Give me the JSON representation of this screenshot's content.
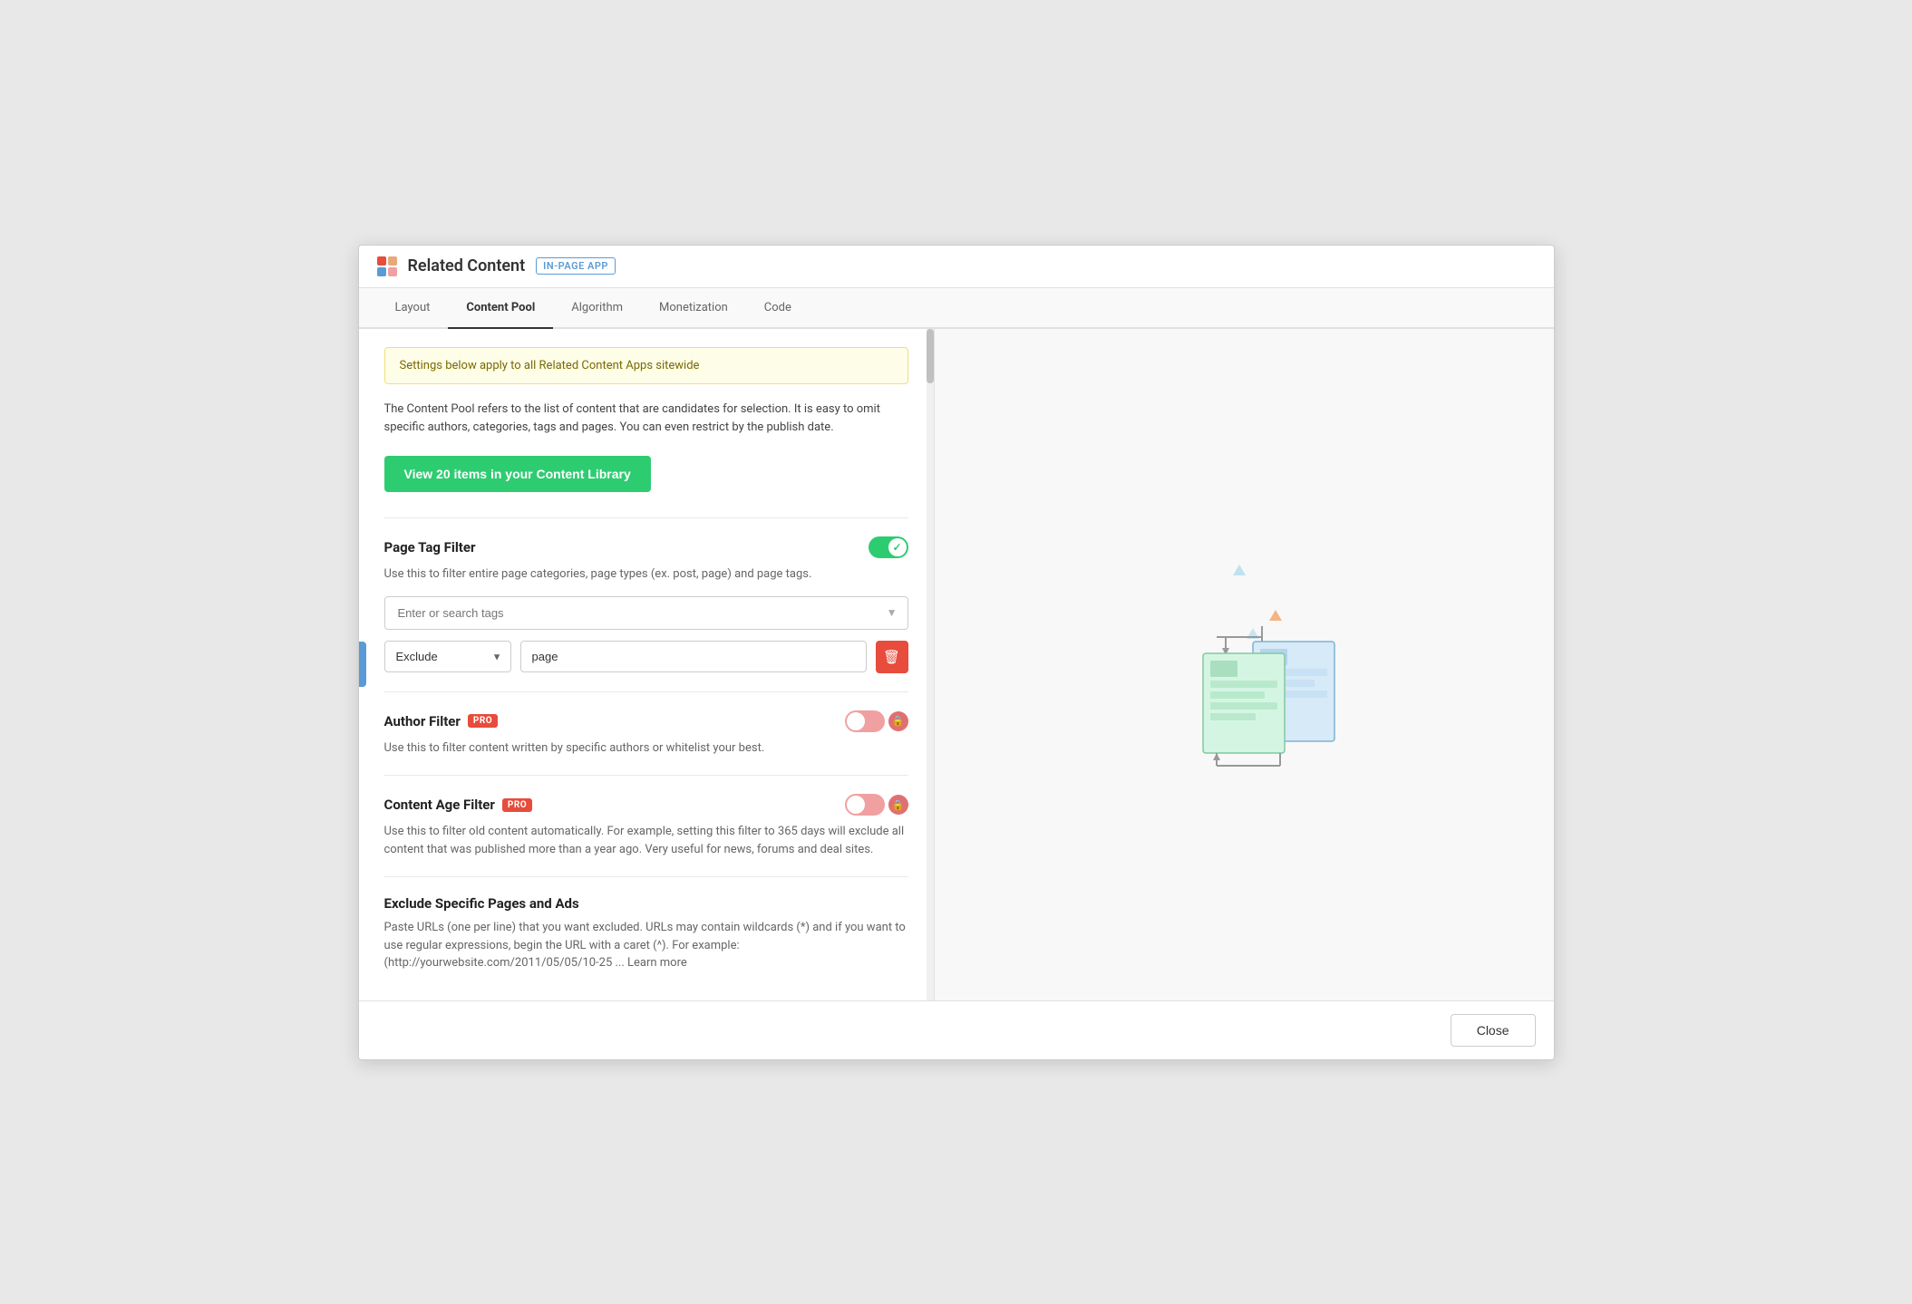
{
  "header": {
    "logo_alt": "Related Content Logo",
    "title": "Related Content",
    "badge": "IN-PAGE APP"
  },
  "tabs": [
    {
      "label": "Layout",
      "active": false
    },
    {
      "label": "Content Pool",
      "active": true
    },
    {
      "label": "Algorithm",
      "active": false
    },
    {
      "label": "Monetization",
      "active": false
    },
    {
      "label": "Code",
      "active": false
    }
  ],
  "notice": {
    "text": "Settings below apply to all Related Content Apps sitewide"
  },
  "description": {
    "text": "The Content Pool refers to the list of content that are candidates for selection. It is easy to omit specific authors, categories, tags and pages. You can even restrict by the publish date."
  },
  "content_library_btn": "View 20 items in your Content Library",
  "page_tag_filter": {
    "title": "Page Tag Filter",
    "toggle_on": true,
    "desc": "Use this to filter entire page categories, page types (ex. post, page) and page tags.",
    "search_placeholder": "Enter or search tags",
    "filter_type": "Exclude",
    "filter_value": "page"
  },
  "author_filter": {
    "title": "Author Filter",
    "pro": true,
    "toggle_on": false,
    "desc": "Use this to filter content written by specific authors or whitelist your best."
  },
  "content_age_filter": {
    "title": "Content Age Filter",
    "pro": true,
    "toggle_on": false,
    "desc": "Use this to filter old content automatically. For example, setting this filter to 365 days will exclude all content that was published more than a year ago. Very useful for news, forums and deal sites."
  },
  "exclude_pages": {
    "title": "Exclude Specific Pages and Ads",
    "desc": "Paste URLs (one per line) that you want excluded. URLs may contain wildcards (*) and if you want to use regular expressions, begin the URL with a caret (^). For example: (http://yourwebsite.com/2011/05/05/10-25 ...  Learn more"
  },
  "footer": {
    "close_label": "Close"
  }
}
